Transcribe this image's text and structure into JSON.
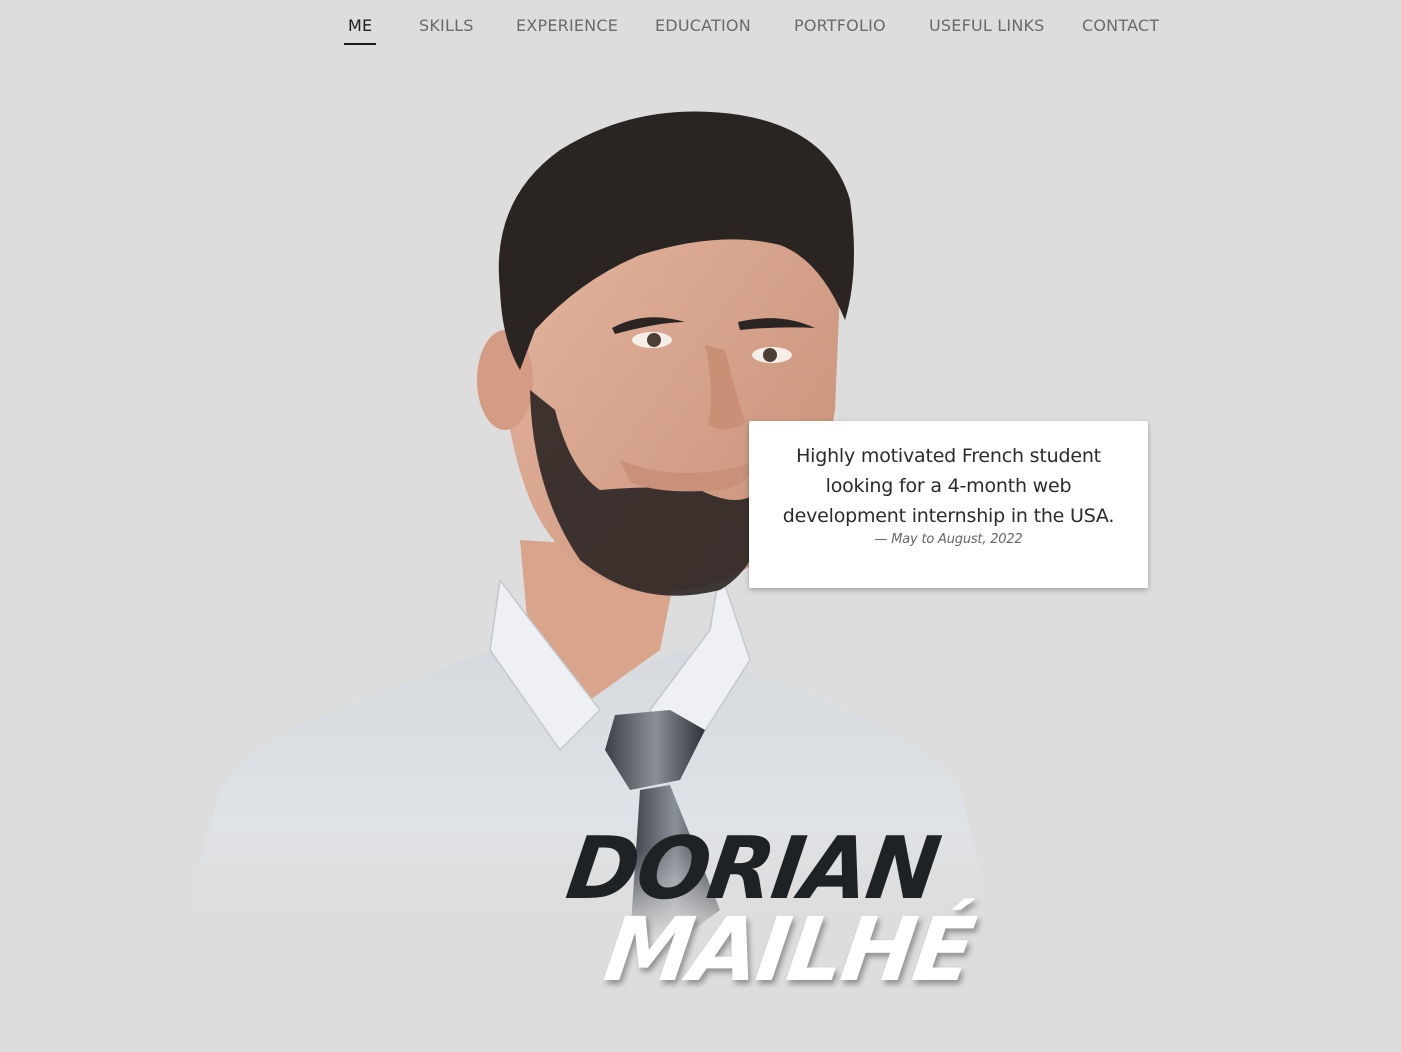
{
  "nav": {
    "items": [
      {
        "label": "ME",
        "active": true
      },
      {
        "label": "SKILLS",
        "active": false
      },
      {
        "label": "EXPERIENCE",
        "active": false
      },
      {
        "label": "EDUCATION",
        "active": false
      },
      {
        "label": "PORTFOLIO",
        "active": false
      },
      {
        "label": "USEFUL LINKS",
        "active": false
      },
      {
        "label": "CONTACT",
        "active": false
      }
    ]
  },
  "hero": {
    "quote": "Highly motivated French student looking for a 4-month web development internship in the USA.",
    "quote_source": "— May to August, 2022",
    "first_name": "DORIAN",
    "last_name": "MAILHÉ"
  },
  "colors": {
    "background": "#dedddd",
    "nav_text": "#6a6a6a",
    "nav_active": "#1c1c1c",
    "first_name": "#1f2224",
    "last_name": "#ffffff",
    "card": "#ffffff"
  },
  "icons": {
    "portrait": "person-portrait"
  }
}
